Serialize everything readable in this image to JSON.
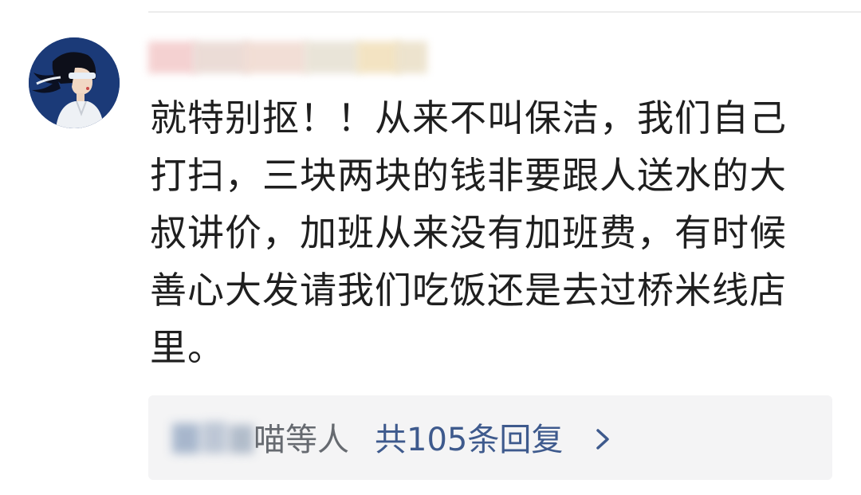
{
  "comment": {
    "username": "",
    "text": "就特别抠！！从来不叫保洁，我们自己打扫，三块两块的钱非要跟人送水的大叔讲价，加班从来没有加班费，有时候善心大发请我们吃饭还是去过桥米线店里。"
  },
  "replies": {
    "names_visible": "喵等人",
    "count_label": "共105条回复",
    "chevron_icon": "chevron-right-icon"
  },
  "colors": {
    "text": "#1f1f1f",
    "link": "#3e5a8d",
    "reply_bg": "#f4f4f5",
    "avatar_bg": "#1b3a78"
  }
}
